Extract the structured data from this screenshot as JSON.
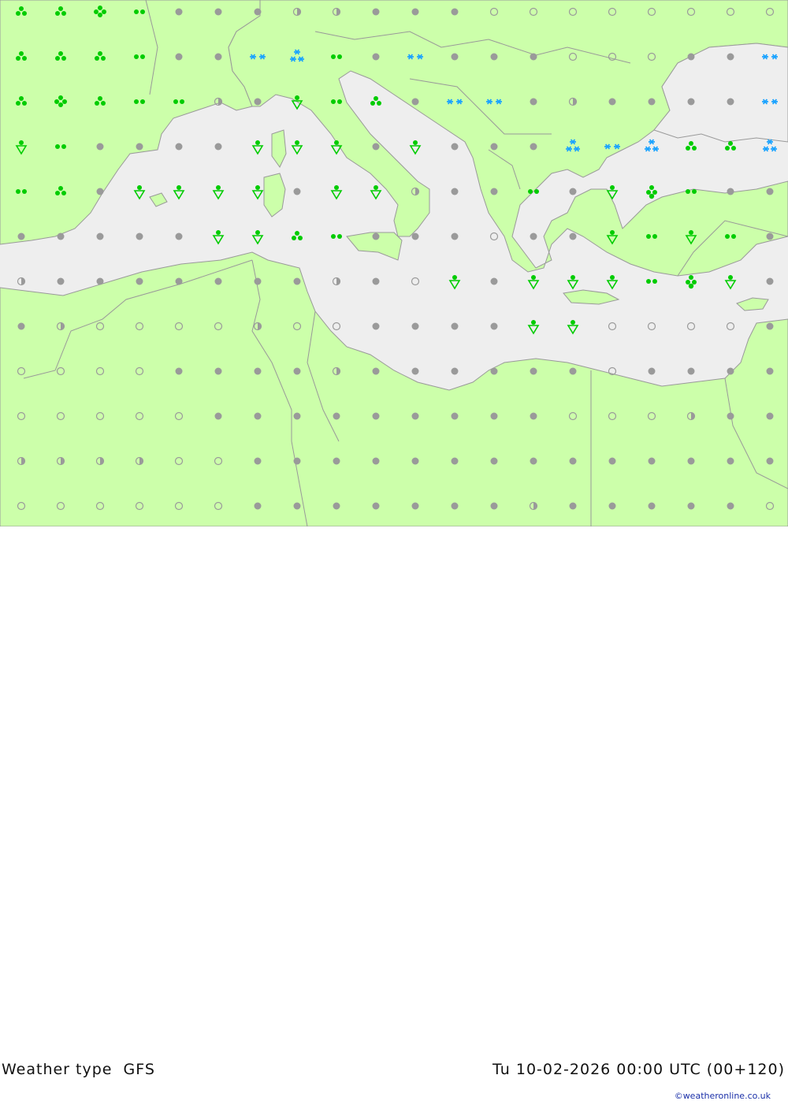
{
  "title_left": "Weather type  GFS",
  "title_right": "Tu 10-02-2026 00:00 UTC (00+120)",
  "credit": "©weatheronline.co.uk",
  "colors": {
    "land": "#ccffaa",
    "sea": "#eeeeee",
    "border": "#999999",
    "cloudy": "#9a9a9a",
    "rain": "#00cc00",
    "snow": "#1aa3ff"
  },
  "legend_codes": {
    "c": "overcast-dot",
    "p": "partly-cloudy-dot",
    "o": "clear-circle",
    "r": "rain-drops",
    "R": "heavy-rain-drops",
    "d": "drizzle-dots",
    "s": "rain-shower-triangle",
    "S": "sleet-shower-triangle",
    "n": "snow-stars",
    "N": "heavy-snow-stars",
    "x": "thunder-drops"
  },
  "grid": {
    "columns": 20,
    "rows": 12,
    "symbols": [
      "rrRdcccppcccoooooooo",
      "rrrdccnNdcncccoooccn",
      "rRrddpcsdrcnncpccccn",
      "sdccccssscscccNnNrrN",
      "drcsssscsspccdcsxdcc",
      "cccccssrdcccoccsdsdcc",
      "pcccccccpcoscsssdxsc",
      "cpoooopooccccssoooocc",
      "ooooccccpccccccocccc",
      "ooooocccccccccooopccp",
      "ppppoocccccccccccccc",
      "oooooocccccccpccccco"
    ]
  }
}
